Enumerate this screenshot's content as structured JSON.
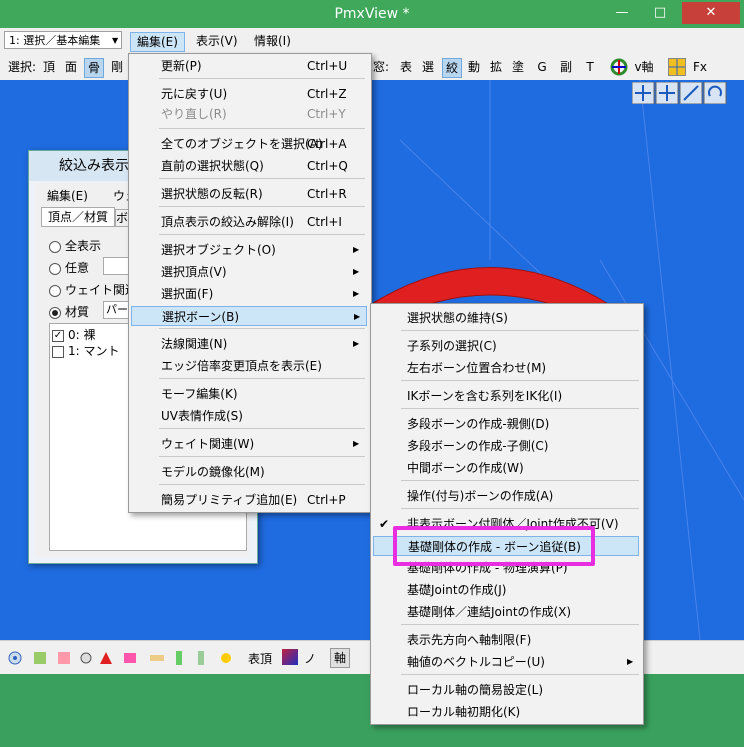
{
  "window": {
    "title": "PmxView *",
    "min": "—",
    "max": "□",
    "close": "✕"
  },
  "menubar": {
    "mode_select": "1: 選択／基本編集",
    "items": [
      "編集(E)",
      "表示(V)",
      "情報(I)"
    ]
  },
  "toolbar": {
    "left": [
      "選択:",
      "頂",
      "面",
      "骨",
      "剛"
    ],
    "right": [
      "窓:",
      "表",
      "選",
      "絞",
      "動",
      "拡",
      "塗",
      "G",
      "副",
      "T"
    ],
    "v_axis": "v軸",
    "fx": "Fx"
  },
  "filter_window": {
    "title": "絞込み表示",
    "menu": [
      "編集(E)",
      "ウェ"
    ],
    "tabs": [
      "頂点／材質",
      "ボ"
    ],
    "radios": [
      "全表示",
      "任意",
      "ウェイト関連",
      "材質"
    ],
    "material_combo": "パー",
    "materials": [
      "0: 裸",
      "1: マント"
    ]
  },
  "main_menu": {
    "items": [
      {
        "label": "更新(P)",
        "shortcut": "Ctrl+U"
      },
      {
        "label": "元に戻す(U)",
        "shortcut": "Ctrl+Z"
      },
      {
        "label": "やり直し(R)",
        "shortcut": "Ctrl+Y"
      },
      {
        "label": "全てのオブジェクトを選択(A)",
        "shortcut": "Ctrl+A"
      },
      {
        "label": "直前の選択状態(Q)",
        "shortcut": "Ctrl+Q"
      },
      {
        "label": "選択状態の反転(R)",
        "shortcut": "Ctrl+R"
      },
      {
        "label": "頂点表示の絞込み解除(I)",
        "shortcut": "Ctrl+I"
      },
      {
        "label": "選択オブジェクト(O)",
        "shortcut": ""
      },
      {
        "label": "選択頂点(V)",
        "shortcut": ""
      },
      {
        "label": "選択面(F)",
        "shortcut": ""
      },
      {
        "label": "選択ボーン(B)",
        "shortcut": ""
      },
      {
        "label": "法線関連(N)",
        "shortcut": ""
      },
      {
        "label": "エッジ倍率変更頂点を表示(E)",
        "shortcut": ""
      },
      {
        "label": "モーフ編集(K)",
        "shortcut": ""
      },
      {
        "label": "UV表情作成(S)",
        "shortcut": ""
      },
      {
        "label": "ウェイト関連(W)",
        "shortcut": ""
      },
      {
        "label": "モデルの鏡像化(M)",
        "shortcut": ""
      },
      {
        "label": "簡易プリミティブ追加(E)",
        "shortcut": "Ctrl+P"
      }
    ]
  },
  "sub_menu": {
    "items": [
      {
        "label": "選択状態の維持(S)"
      },
      {
        "label": "子系列の選択(C)"
      },
      {
        "label": "左右ボーン位置合わせ(M)"
      },
      {
        "label": "IKボーンを含む系列をIK化(I)"
      },
      {
        "label": "多段ボーンの作成-親側(D)"
      },
      {
        "label": "多段ボーンの作成-子側(C)"
      },
      {
        "label": "中間ボーンの作成(W)"
      },
      {
        "label": "操作(付与)ボーンの作成(A)"
      },
      {
        "label": "非表示ボーン付剛体／Joint作成不可(V)"
      },
      {
        "label": "基礎剛体の作成 - ボーン追従(B)"
      },
      {
        "label": "基礎剛体の作成 - 物理演算(P)"
      },
      {
        "label": "基礎Jointの作成(J)"
      },
      {
        "label": "基礎剛体／連結Jointの作成(X)"
      },
      {
        "label": "表示先方向へ軸制限(F)"
      },
      {
        "label": "軸値のベクトルコピー(U)"
      },
      {
        "label": "ローカル軸の簡易設定(L)"
      },
      {
        "label": "ローカル軸初期化(K)"
      }
    ]
  },
  "bottombar": {
    "labels": [
      "表頂",
      "ノ",
      "軸"
    ]
  },
  "colors": {
    "viewport": "#1f6be0",
    "highlight": "#e82ee0",
    "model": "#e02020"
  }
}
